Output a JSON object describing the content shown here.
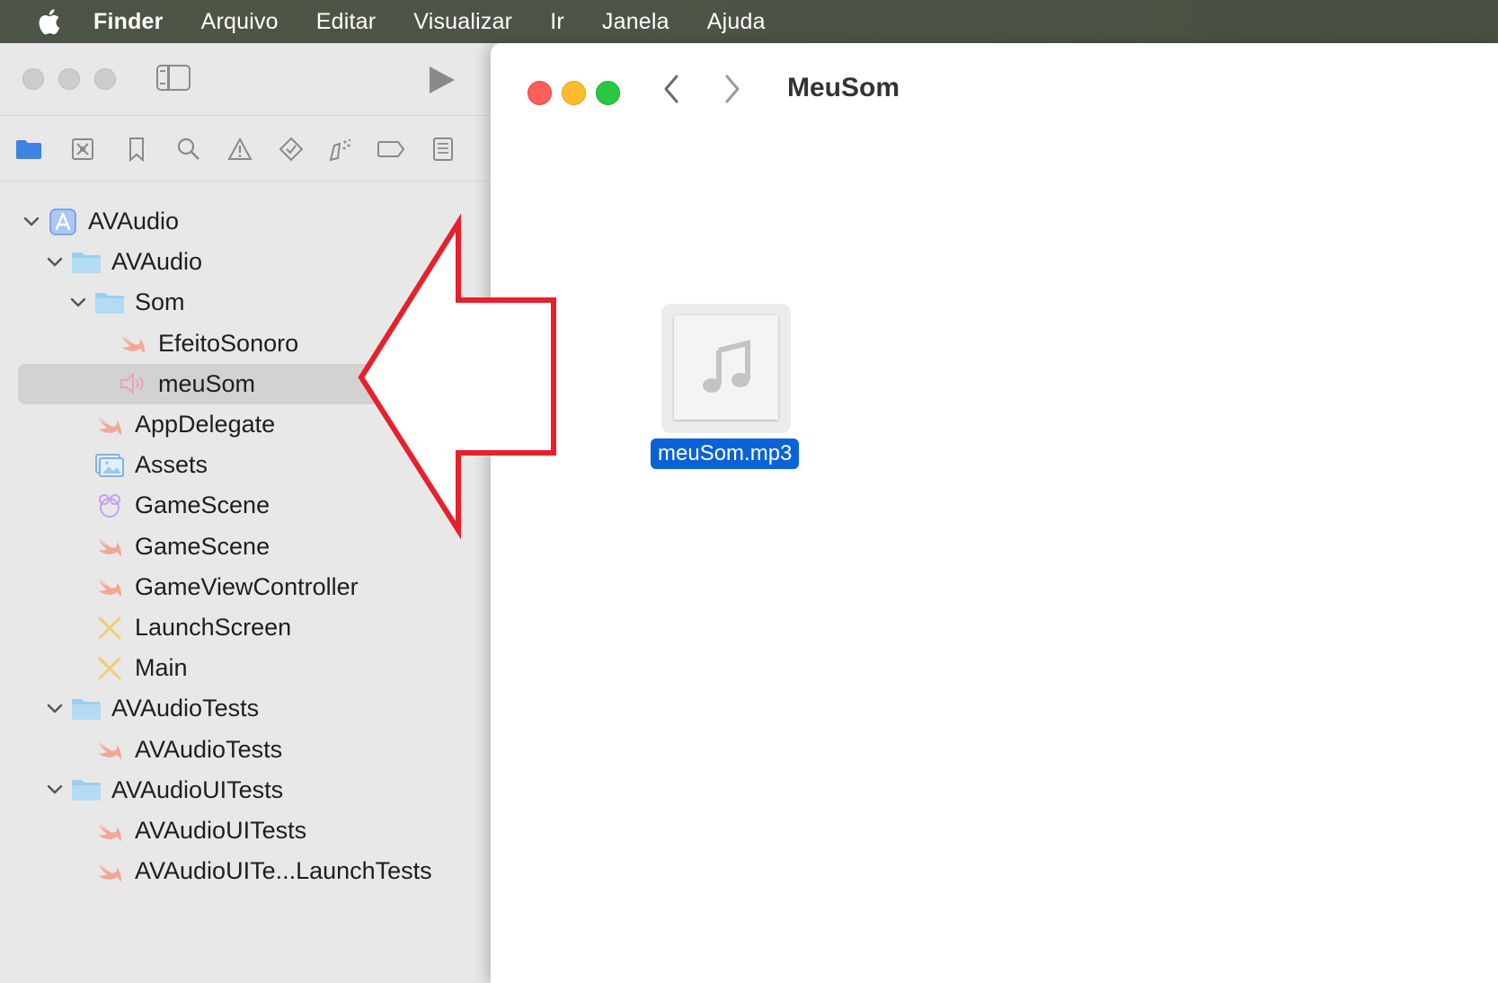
{
  "menubar": {
    "app": "Finder",
    "items": [
      "Arquivo",
      "Editar",
      "Visualizar",
      "Ir",
      "Janela",
      "Ajuda"
    ]
  },
  "xcode": {
    "navigator_icons": [
      "folder-icon",
      "source-control-icon",
      "bookmark-icon",
      "search-icon",
      "warning-icon",
      "test-icon",
      "debug-icon",
      "breakpoint-icon",
      "report-icon"
    ],
    "tree": [
      {
        "label": "AVAudio",
        "level": 0,
        "expanded": true,
        "icon": "project-icon"
      },
      {
        "label": "AVAudio",
        "level": 1,
        "expanded": true,
        "icon": "folder-icon"
      },
      {
        "label": "Som",
        "level": 2,
        "expanded": true,
        "icon": "folder-icon"
      },
      {
        "label": "EfeitoSonoro",
        "level": 3,
        "icon": "swift-icon"
      },
      {
        "label": "meuSom",
        "level": 3,
        "icon": "audio-file-icon",
        "selected": true
      },
      {
        "label": "AppDelegate",
        "level": 2,
        "icon": "swift-icon"
      },
      {
        "label": "Assets",
        "level": 2,
        "icon": "asset-catalog-icon"
      },
      {
        "label": "GameScene",
        "level": 2,
        "icon": "spritekit-scene-icon"
      },
      {
        "label": "GameScene",
        "level": 2,
        "icon": "swift-icon"
      },
      {
        "label": "GameViewController",
        "level": 2,
        "icon": "swift-icon"
      },
      {
        "label": "LaunchScreen",
        "level": 2,
        "icon": "storyboard-icon"
      },
      {
        "label": "Main",
        "level": 2,
        "icon": "storyboard-icon"
      },
      {
        "label": "AVAudioTests",
        "level": 1,
        "expanded": true,
        "icon": "folder-icon"
      },
      {
        "label": "AVAudioTests",
        "level": 2,
        "icon": "swift-icon"
      },
      {
        "label": "AVAudioUITests",
        "level": 1,
        "expanded": true,
        "icon": "folder-icon"
      },
      {
        "label": "AVAudioUITests",
        "level": 2,
        "icon": "swift-icon"
      },
      {
        "label": "AVAudioUITe...LaunchTests",
        "level": 2,
        "icon": "swift-icon"
      }
    ]
  },
  "finder": {
    "title": "MeuSom",
    "file": {
      "name": "meuSom.mp3",
      "icon": "music-note-icon"
    }
  },
  "colors": {
    "close": "#fe5f57",
    "minimize": "#febc2e",
    "zoom": "#28c840",
    "selection": "#0a63d6",
    "arrow": "#e8202a"
  }
}
